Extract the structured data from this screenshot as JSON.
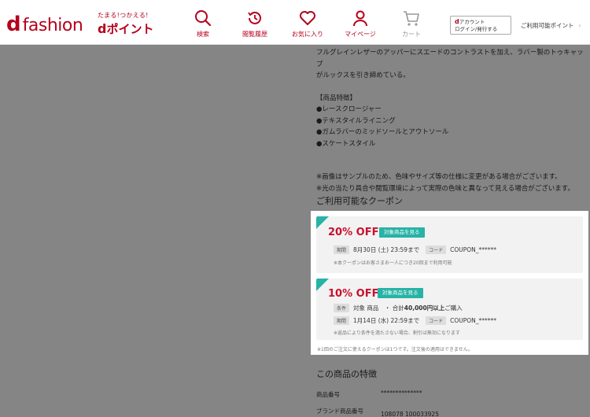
{
  "header": {
    "logo_d": "d",
    "logo_fashion": "fashion",
    "dpoint_tagline": "たまる!つかえる!",
    "dpoint_d": "d",
    "dpoint_label": "ポイント",
    "nav": [
      {
        "label": "検索",
        "icon": "search-icon"
      },
      {
        "label": "閲覧履歴",
        "icon": "history-icon"
      },
      {
        "label": "お気に入り",
        "icon": "heart-icon"
      },
      {
        "label": "マイページ",
        "icon": "person-icon"
      },
      {
        "label": "カート",
        "icon": "cart-icon"
      }
    ],
    "account_d": "d",
    "account_line1": "アカウント",
    "account_line2": "ログイン/発行する",
    "coupon_link": "ご利用可能ポイント",
    "coupon_chev": "›"
  },
  "description": {
    "intro1": "フルグレインレザーのアッパーにスエードのコントラストを加え、ラバー製のトゥキャップ",
    "intro2": "がルックスを引き締めている。",
    "features_head": "【商品特徴】",
    "features": [
      "●レースクロージャー",
      "●テキスタイルライニング",
      "●ガムラバーのミッドソールとアウトソール",
      "●スケートスタイル"
    ],
    "notes": [
      "※画像はサンプルのため、色味やサイズ等の仕様に変更がある場合がございます。",
      "※光の当たり具合や閲覧環境によって実際の色味と異なって見える場合がございます。"
    ]
  },
  "coupons": {
    "title": "ご利用可能なクーポン",
    "items": [
      {
        "discount": "20% OFF",
        "button": "対象商品を見る",
        "period_label": "期間",
        "period": "8月30日 (土) 23:59まで",
        "code_label": "コード",
        "code": "COUPON_******",
        "note": "※本クーポンはお客さまお一人につき20回まで利用可能"
      },
      {
        "discount": "10% OFF",
        "button": "対象商品を見る",
        "condition_label": "条件",
        "condition_pre": "対象 商品　・ 合計",
        "condition_bold": "40,000円以上",
        "condition_post": "ご購入",
        "period_label": "期間",
        "period": "1月14日 (水) 22:59まで",
        "code_label": "コード",
        "code": "COUPON_******",
        "note": "※返品により条件を満たさない場合、割引は無効になります"
      }
    ],
    "footer_note": "※1回のご注文に使えるクーポンは1つです。注文後の適用はできません。"
  },
  "product": {
    "title": "この商品の特徴",
    "specs": [
      {
        "label": "商品番号",
        "value": "**************"
      },
      {
        "label": "ブランド商品番号",
        "value": "108078 100033925"
      }
    ]
  },
  "colors": {
    "brand": "#b5001b",
    "teal": "#27b3a6",
    "discount": "#c8102e"
  }
}
